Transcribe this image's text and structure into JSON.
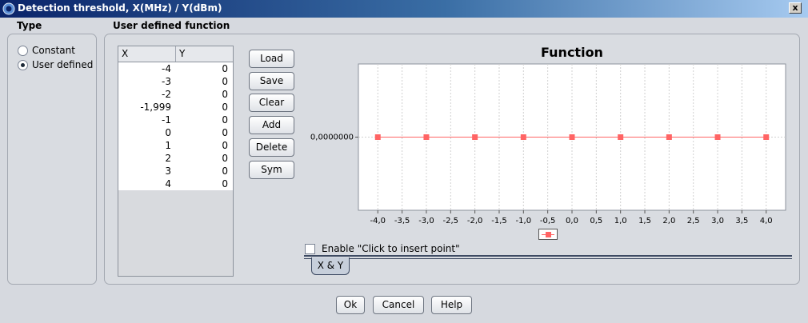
{
  "window": {
    "title": "Detection threshold, X(MHz) / Y(dBm)",
    "close_label": "x"
  },
  "type_panel": {
    "label": "Type",
    "options": [
      {
        "label": "Constant",
        "checked": false
      },
      {
        "label": "User defined",
        "checked": true
      }
    ]
  },
  "function_panel": {
    "label": "User defined function",
    "table": {
      "columns": [
        "X",
        "Y"
      ],
      "rows": [
        {
          "x": "-4",
          "y": "0"
        },
        {
          "x": "-3",
          "y": "0"
        },
        {
          "x": "-2",
          "y": "0"
        },
        {
          "x": "-1,999",
          "y": "0"
        },
        {
          "x": "-1",
          "y": "0"
        },
        {
          "x": "0",
          "y": "0"
        },
        {
          "x": "1",
          "y": "0"
        },
        {
          "x": "2",
          "y": "0"
        },
        {
          "x": "3",
          "y": "0"
        },
        {
          "x": "4",
          "y": "0"
        }
      ]
    },
    "buttons": [
      "Load",
      "Save",
      "Clear",
      "Add",
      "Delete",
      "Sym"
    ],
    "enable_click_label": "Enable \"Click to insert point\"",
    "enable_click_checked": false,
    "tab_label": "X & Y"
  },
  "chart_data": {
    "type": "line",
    "title": "Function",
    "xlabel": "",
    "ylabel": "",
    "xlim": [
      -4.4,
      4.4
    ],
    "x_ticks": [
      "-4,0",
      "-3,5",
      "-3,0",
      "-2,5",
      "-2,0",
      "-1,5",
      "-1,0",
      "-0,5",
      "0,0",
      "0,5",
      "1,0",
      "1,5",
      "2,0",
      "2,5",
      "3,0",
      "3,5",
      "4,0"
    ],
    "x_tick_values": [
      -4,
      -3.5,
      -3,
      -2.5,
      -2,
      -1.5,
      -1,
      -0.5,
      0,
      0.5,
      1,
      1.5,
      2,
      2.5,
      3,
      3.5,
      4
    ],
    "y_ticks": [
      "0,0000000"
    ],
    "y_tick_values": [
      0
    ],
    "grid": true,
    "legend": "bottom-center",
    "series": [
      {
        "color": "#ff6464",
        "x": [
          -4,
          -3,
          -2,
          -1,
          0,
          1,
          2,
          3,
          4
        ],
        "y": [
          0,
          0,
          0,
          0,
          0,
          0,
          0,
          0,
          0
        ]
      }
    ]
  },
  "footer": {
    "ok_label": "Ok",
    "cancel_label": "Cancel",
    "help_label": "Help"
  },
  "icons": {
    "window": "app-icon",
    "close": "close-icon",
    "legend": "legend-swatch-icon"
  }
}
